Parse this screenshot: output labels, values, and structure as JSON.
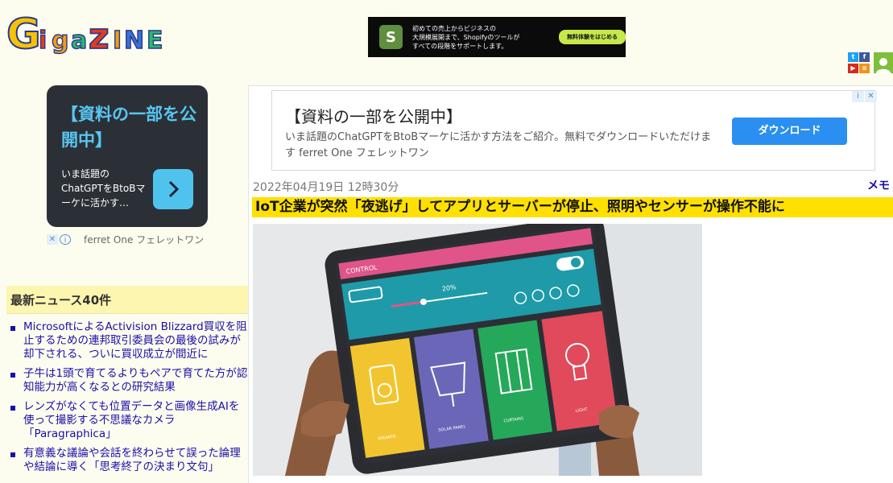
{
  "site": {
    "logo_text": "GigazINE"
  },
  "top_banner": {
    "line1": "初めての売上からビジネスの",
    "line2": "大規模展開まで、Shopifyのツールが",
    "line3": "すべての段階をサポートします。",
    "cta": "無料体験をはじめる",
    "icon": "shopify-bag-icon"
  },
  "social": {
    "twitter": "t",
    "facebook": "f",
    "youtube": "▶",
    "rss": "≋"
  },
  "side_ad": {
    "headline": "【資料の一部を公開中】",
    "description": "いま話題のChatGPTをBtoBマーケに活かす…",
    "close": "✕",
    "info": "i",
    "brand": "ferret One フェレットワン"
  },
  "main_ad": {
    "headline": "【資料の一部を公開中】",
    "description": "いま話題のChatGPTをBtoBマーケに活かす方法をご紹介。無料でダウンロードいただけます ferret One フェレットワン",
    "download": "ダウンロード",
    "info": "i",
    "close": "✕"
  },
  "news": {
    "heading": "最新ニュース40件",
    "items": [
      "MicrosoftによるActivision Blizzard買収を阻止するための連邦取引委員会の最後の試みが却下される、ついに買収成立が間近に",
      "子牛は1頭で育てるよりもペアで育てた方が認知能力が高くなるとの研究結果",
      "レンズがなくても位置データと画像生成AIを使って撮影する不思議なカメラ「Paragraphica」",
      "有意義な議論や会話を終わらせて誤った論理や結論に導く「思考終了の決まり文句」"
    ]
  },
  "article": {
    "date": "2022年04月19日 12時30分",
    "category": "メモ",
    "title": "IoT企業が突然「夜逃げ」してアプリとサーバーが停止、照明やセンサーが操作不能に"
  },
  "hero": {
    "control_label": "CONTROL",
    "percent": "20%",
    "tile_labels": [
      "SPEAKER",
      "SOLAR PANEL",
      "CURTAINS",
      "LIGHT"
    ]
  },
  "colors": {
    "page_bg": "#fdfdef",
    "title_bar": "#ffe000",
    "link": "#1a0dab",
    "news_head_bg": "#fcf6b0",
    "ad_dark": "#2b3037",
    "ad_accent": "#58c6f0"
  }
}
